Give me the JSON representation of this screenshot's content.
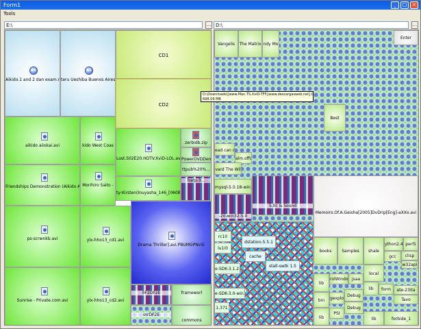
{
  "window": {
    "title": "Form1"
  },
  "menu": {
    "items": [
      "Tools"
    ]
  },
  "left_panel": {
    "path": "E:\\",
    "browse_label": "...",
    "tiles": [
      {
        "label": "Aikido.1 and 2 dan exam.mpg",
        "icon": "BS"
      },
      {
        "label": "teru Ueshiba Buenos Aires",
        "icon": "BS"
      },
      {
        "label": "CD1"
      },
      {
        "label": "CD2"
      },
      {
        "label": "aikido aiiokai.avi"
      },
      {
        "label": "kido West Coas"
      },
      {
        "label": "Lost.S02E20.HDTV.XviD-LOL.avi"
      },
      {
        "label": "zerbidb.zip"
      },
      {
        "label": "PowerDVDDemo.zip"
      },
      {
        "label": "Friendships Demonstration (Aikido And Kory"
      },
      {
        "label": "Morihiro Saito -"
      },
      {
        "label": "ttpub%20%..."
      },
      {
        "label": "ty-Kirsten(Inuyasha_146_[060B74CF]"
      },
      {
        "label": "harp-3..."
      },
      {
        "label": "ps-scrwnkb.avi"
      },
      {
        "label": "ylx-hho13_cd1.avi"
      },
      {
        "label": "Drama Thriller].avi.PBUMGPNv5i"
      },
      {
        "label": "Sunrise - Private.com.avi"
      },
      {
        "label": "ylx-hho13_cd2.avi"
      },
      {
        "label": "0F2DF2E"
      },
      {
        "label": "frameworl"
      },
      {
        "label": "orrDF2E"
      },
      {
        "label": "commons"
      }
    ]
  },
  "right_panel": {
    "path": "D:\\",
    "browse_label": "...",
    "tiles": [
      {
        "label": "Vangelis"
      },
      {
        "label": "The Matrix"
      },
      {
        "label": "ndy Mo"
      },
      {
        "label": "Enter"
      },
      {
        "label": "Best"
      },
      {
        "label": "ead can dan"
      },
      {
        "label": "alm.offc"
      },
      {
        "label": "vard The Wil"
      },
      {
        "label": "mysql-5.0.18-win32"
      },
      {
        "label": "5.0c & Sound"
      },
      {
        "label": "-20-win32-5.0"
      },
      {
        "label": "Memoirs.Of.A.Geisha[2005]DvDrip[Eng]-aXXo.avi"
      },
      {
        "label": "rc10"
      },
      {
        "label": "lu1i0"
      },
      {
        "label": "dstation-5.5.1"
      },
      {
        "label": "books"
      },
      {
        "label": "Samples"
      },
      {
        "label": "shale"
      },
      {
        "label": "ython2.4"
      },
      {
        "label": "perl5"
      },
      {
        "label": "e-SDK-3.1.2-win"
      },
      {
        "label": "cache"
      },
      {
        "label": "stall-swtk 1.5"
      },
      {
        "label": "local"
      },
      {
        "label": "gcc"
      },
      {
        "label": "clisp"
      },
      {
        "label": "w32api"
      },
      {
        "label": "rolWindo"
      },
      {
        "label": "lib"
      },
      {
        "label": "lib"
      },
      {
        "label": "jsaa"
      },
      {
        "label": "e-SDK-3.0-win32"
      },
      {
        "label": "Debug"
      },
      {
        "label": "form"
      },
      {
        "label": "ate-23ita"
      },
      {
        "label": "Tavo"
      },
      {
        "label": "gexploi"
      },
      {
        "label": "bin"
      },
      {
        "label": "lib"
      },
      {
        "label": "1.371"
      },
      {
        "label": "PSI"
      },
      {
        "label": "Debug"
      },
      {
        "label": "lib"
      },
      {
        "label": "forbide_1"
      }
    ]
  },
  "tooltip": {
    "line1": "D:\\Downloads\\[www.Man.TS.XviD-TFF.[www.descargasweb.net].CD2",
    "line2": "698.09 MB"
  },
  "colors": {
    "title_bar": "#0a5ce8",
    "tile_green": "#8cf06a",
    "tile_blue": "#2a3ee0",
    "tile_lightblue": "#d6ebf6",
    "tile_yellowgreen": "#c8f078"
  }
}
